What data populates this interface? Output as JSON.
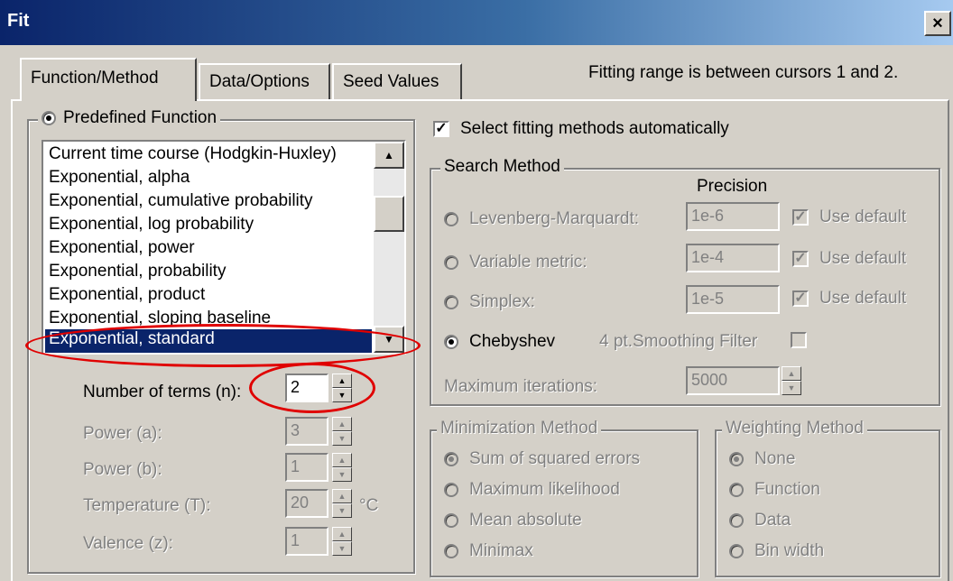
{
  "window": {
    "title": "Fit",
    "close_glyph": "×"
  },
  "tabs": [
    {
      "label": "Function/Method",
      "active": true
    },
    {
      "label": "Data/Options",
      "active": false
    },
    {
      "label": "Seed Values",
      "active": false
    }
  ],
  "fitting_note": "Fitting range is between cursors 1 and 2.",
  "predefined": {
    "label": "Predefined Function",
    "selected": true,
    "functions": [
      "Current time course (Hodgkin-Huxley)",
      "Exponential, alpha",
      "Exponential, cumulative probability",
      "Exponential, log probability",
      "Exponential, power",
      "Exponential, probability",
      "Exponential, product",
      "Exponential, sloping baseline",
      "Exponential, standard"
    ],
    "selected_function": "Exponential, standard"
  },
  "params": [
    {
      "label": "Number of terms (n):",
      "value": "2",
      "enabled": true,
      "unit": ""
    },
    {
      "label": "Power (a):",
      "value": "3",
      "enabled": false,
      "unit": ""
    },
    {
      "label": "Power (b):",
      "value": "1",
      "enabled": false,
      "unit": ""
    },
    {
      "label": "Temperature (T):",
      "value": "20",
      "enabled": false,
      "unit": "°C"
    },
    {
      "label": "Valence (z):",
      "value": "1",
      "enabled": false,
      "unit": ""
    }
  ],
  "auto_methods": {
    "label": "Select fitting methods automatically",
    "checked": true
  },
  "search": {
    "legend": "Search Method",
    "precision_header": "Precision",
    "methods": [
      {
        "label": "Levenberg-Marquardt:",
        "precision": "1e-6",
        "use_default": "Use default",
        "selected": false
      },
      {
        "label": "Variable metric:",
        "precision": "1e-4",
        "use_default": "Use default",
        "selected": false
      },
      {
        "label": "Simplex:",
        "precision": "1e-5",
        "use_default": "Use default",
        "selected": false
      },
      {
        "label": "Chebyshev",
        "selected": true
      }
    ],
    "smoothing_label": "4 pt.Smoothing Filter",
    "max_iter_label": "Maximum iterations:",
    "max_iter_value": "5000"
  },
  "minimization": {
    "legend": "Minimization Method",
    "options": [
      "Sum of squared errors",
      "Maximum likelihood",
      "Mean absolute",
      "Minimax"
    ],
    "selected": 0
  },
  "weighting": {
    "legend": "Weighting Method",
    "options": [
      "None",
      "Function",
      "Data",
      "Bin width"
    ],
    "selected": 0
  },
  "colors": {
    "titlebar": "#0a246a",
    "selection": "#0a246a",
    "annotation": "#e00000"
  }
}
